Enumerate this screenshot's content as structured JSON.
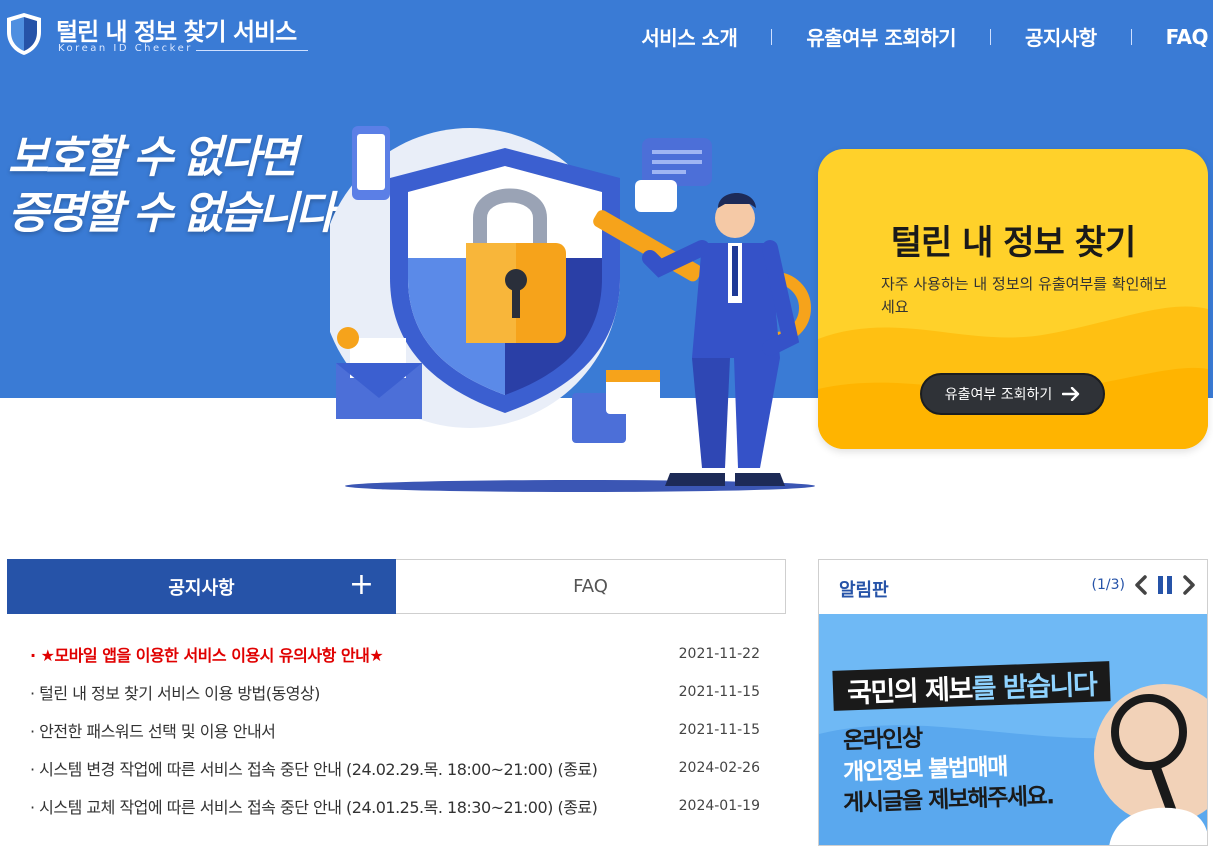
{
  "header": {
    "title": "털린 내 정보 찾기 서비스",
    "subtitle": "Korean ID Checker",
    "nav": [
      "서비스 소개",
      "유출여부 조회하기",
      "공지사항",
      "FAQ"
    ]
  },
  "hero": {
    "slogan_line1": "보호할 수 없다면",
    "slogan_line2": "증명할 수 없습니다",
    "card_title": "털린 내 정보 찾기",
    "card_desc": "자주 사용하는 내 정보의 유출여부를 확인해보세요",
    "card_button": "유출여부 조회하기"
  },
  "tabs": {
    "active": "공지사항",
    "inactive": "FAQ",
    "more_label": "+"
  },
  "notices": [
    {
      "title": "· ★모바일 앱을 이용한 서비스 이용시 유의사항 안내★",
      "date": "2021-11-22",
      "highlight": true
    },
    {
      "title": "· 털린 내 정보 찾기 서비스 이용 방법(동영상)",
      "date": "2021-11-15",
      "highlight": false
    },
    {
      "title": "· 안전한 패스워드 선택 및 이용 안내서",
      "date": "2021-11-15",
      "highlight": false
    },
    {
      "title": "· 시스템 변경 작업에 따른 서비스 접속 중단 안내 (24.02.29.목. 18:00~21:00) (종료)",
      "date": "2024-02-26",
      "highlight": false
    },
    {
      "title": "· 시스템 교체 작업에 따른 서비스 접속 중단 안내 (24.01.25.목. 18:30~21:00) (종료)",
      "date": "2024-01-19",
      "highlight": false
    }
  ],
  "board": {
    "title": "알림판",
    "page": "(1/3)",
    "banner_title_a": "국민의 제보",
    "banner_title_b": "를 받습니다",
    "banner_line1": "온라인상",
    "banner_line2": "개인정보 불법매매",
    "banner_line3": "게시글을 제보해주세요."
  },
  "colors": {
    "primary": "#3a7bd5",
    "tab_active": "#2653a8",
    "card_yellow": "#ffd12a",
    "alert_red": "#e00000"
  }
}
